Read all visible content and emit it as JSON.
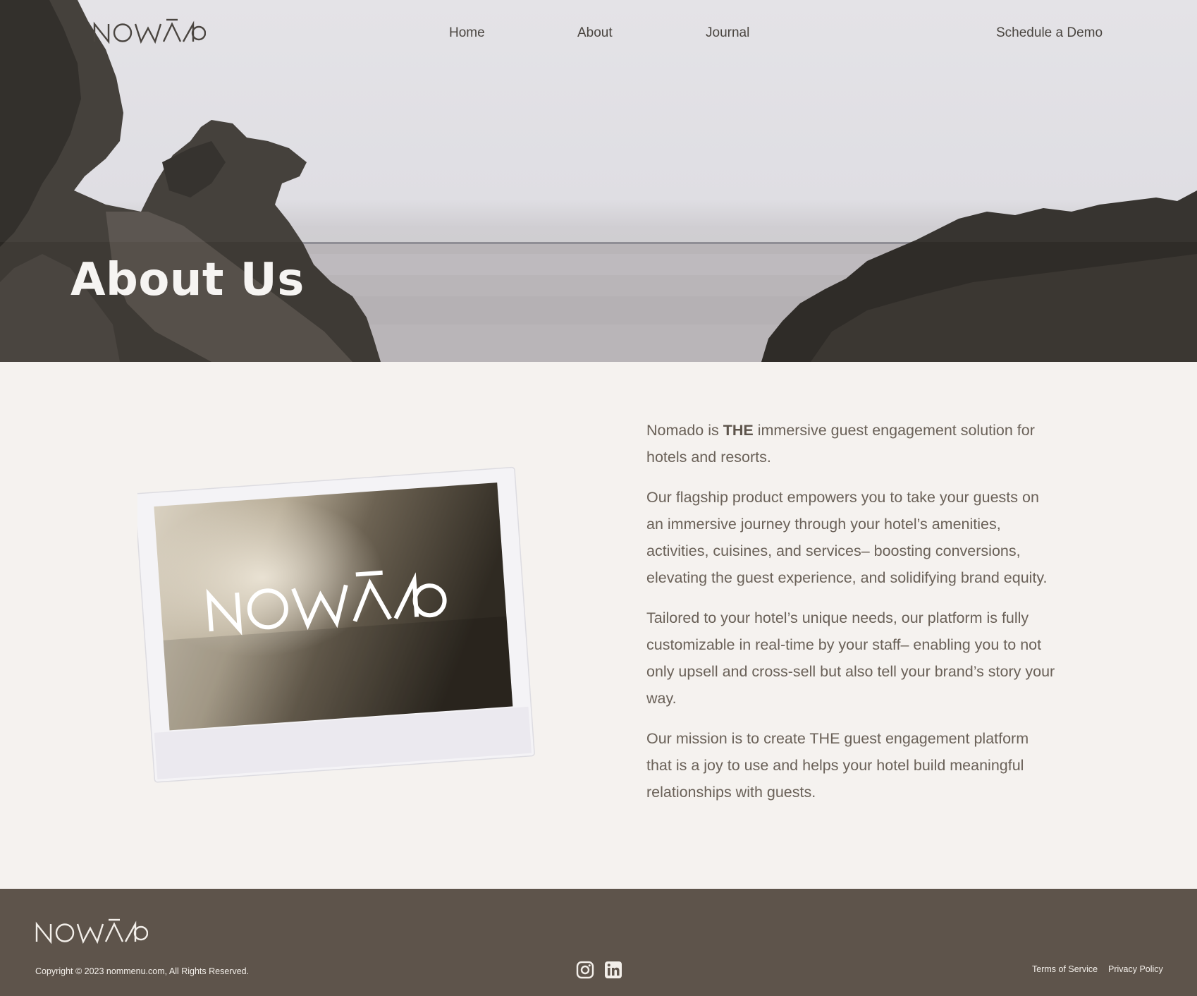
{
  "header": {
    "logo_text": "NOMĀDO",
    "nav": [
      {
        "label": "Home"
      },
      {
        "label": "About"
      },
      {
        "label": "Journal"
      }
    ],
    "cta_label": "Schedule a Demo"
  },
  "hero": {
    "title": "About Us"
  },
  "polaroid": {
    "logo_text": "NOMĀDO"
  },
  "content": {
    "p1_a": "Nomado is ",
    "p1_bold": "THE",
    "p1_b": " immersive guest engagement solution for hotels and resorts.",
    "p2": "Our flagship product empowers you to take your guests on an immersive journey through your hotel’s amenities, activities, cuisines, and services– boosting conversions, elevating the guest experience, and solidifying brand equity.",
    "p3": "Tailored to your hotel’s unique needs, our platform is fully customizable in real-time by your staff– enabling you to not only upsell and cross-sell but also tell your brand’s story your way.",
    "p4": "Our mission is to create THE guest engagement platform that is a joy to use and helps your hotel build meaningful relationships with guests."
  },
  "footer": {
    "logo_text": "NOMĀDO",
    "copyright": "Copyright © 2023 nommenu.com, All Rights Reserved.",
    "social": [
      {
        "icon": "instagram-icon"
      },
      {
        "icon": "linkedin-icon"
      }
    ],
    "links": [
      {
        "label": "Terms of Service"
      },
      {
        "label": "Privacy Policy"
      }
    ]
  },
  "colors": {
    "page_bg": "#f5f2ef",
    "footer_bg": "#5e544b",
    "text": "#6a6158",
    "hero_title": "#f6f4f2"
  }
}
